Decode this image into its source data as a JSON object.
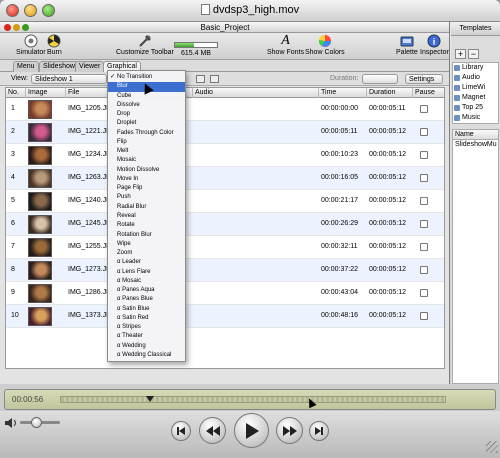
{
  "window": {
    "title": "dvdsp3_high.mov"
  },
  "project": {
    "title": "Basic_Project"
  },
  "toolbar": {
    "simulator_label": "Simulator",
    "burn_label": "Burn",
    "customize_label": "Customize Toolbar",
    "disk_usage_label": "615.4 MB",
    "disk_usage_fraction": 0.45,
    "fonts_label": "Show Fonts",
    "colors_label": "Show Colors",
    "palette_label": "Palette",
    "inspector_label": "Inspector"
  },
  "tabs": {
    "menu": "Menu",
    "slideshow": "Slideshow",
    "viewer": "Viewer",
    "graphical": "Graphical"
  },
  "viewbar": {
    "view_label": "View:",
    "view_value": "Slideshow 1",
    "duration_label": "Duration:",
    "settings_label": "Settings"
  },
  "table": {
    "headers": {
      "no": "No.",
      "image": "Image",
      "file": "File",
      "audio": "Audio",
      "time": "Time",
      "duration": "Duration",
      "pause": "Pause"
    },
    "rows": [
      {
        "no": "1",
        "file": "IMG_1205.JP(",
        "time": "00:00:00:00",
        "duration": "00:00:05:11",
        "thumb_colors": [
          "#7a3a2a",
          "#c78b5a"
        ]
      },
      {
        "no": "2",
        "file": "IMG_1221.JP(",
        "time": "00:00:05:11",
        "duration": "00:00:05:12",
        "thumb_colors": [
          "#3b2a3a",
          "#d45a8a"
        ]
      },
      {
        "no": "3",
        "file": "IMG_1234.JP(",
        "time": "00:00:10:23",
        "duration": "00:00:05:12",
        "thumb_colors": [
          "#2d1a14",
          "#a86b3c"
        ]
      },
      {
        "no": "4",
        "file": "IMG_1263.JP(",
        "time": "00:00:16:05",
        "duration": "00:00:05:12",
        "thumb_colors": [
          "#4a3226",
          "#b79a7a"
        ]
      },
      {
        "no": "5",
        "file": "IMG_1240.JP(",
        "time": "00:00:21:17",
        "duration": "00:00:05:12",
        "thumb_colors": [
          "#1e1a1a",
          "#8a6a4a"
        ]
      },
      {
        "no": "6",
        "file": "IMG_1245.JP(",
        "time": "00:00:26:29",
        "duration": "00:00:05:12",
        "thumb_colors": [
          "#3a2a22",
          "#d8c2a8"
        ]
      },
      {
        "no": "7",
        "file": "IMG_1255.JP(",
        "time": "00:00:32:11",
        "duration": "00:00:05:12",
        "thumb_colors": [
          "#241c18",
          "#9a6a3a"
        ]
      },
      {
        "no": "8",
        "file": "IMG_1273.JP(",
        "time": "00:00:37:22",
        "duration": "00:00:05:12",
        "thumb_colors": [
          "#2a1e1a",
          "#c48a5a"
        ]
      },
      {
        "no": "9",
        "file": "IMG_1286.JP(",
        "time": "00:00:43:04",
        "duration": "00:00:05:12",
        "thumb_colors": [
          "#3a2418",
          "#b07a48"
        ]
      },
      {
        "no": "10",
        "file": "IMG_1373.JP(",
        "time": "00:00:48:16",
        "duration": "00:00:05:12",
        "thumb_colors": [
          "#4a1e2a",
          "#d8a05a"
        ]
      }
    ]
  },
  "transition_menu": {
    "items": [
      "No Transition",
      "Blur",
      "Cube",
      "Dissolve",
      "Drop",
      "Droplet",
      "Fades Through Color",
      "Flip",
      "Melt",
      "Mosaic",
      "Motion Dissolve",
      "Move In",
      "Page Flip",
      "Push",
      "Radial Blur",
      "Reveal",
      "Rotate",
      "Rotation Blur",
      "Wipe",
      "Zoom",
      "α Leader",
      "α Lens Flare",
      "α Mosaic",
      "α Panes Aqua",
      "α Panes Blue",
      "α Satin Blue",
      "α Satin Red",
      "α Stripes",
      "α Theater",
      "α Wedding",
      "α Wedding Classical"
    ],
    "checked_index": 0,
    "highlighted_index": 1
  },
  "right_panel": {
    "tab": "Templates",
    "library_items": [
      "Library",
      "Audio",
      "LimeWi",
      "Magnet",
      "Top 25",
      "Music"
    ],
    "name_header": "Name",
    "name_items": [
      "SlideshowMu"
    ]
  },
  "timeline": {
    "time": "00:00:56",
    "playhead_fraction": 0.23
  },
  "controls": {
    "volume_fraction": 0.4
  },
  "colors": {
    "highlight": "#3d6fd1",
    "alt_row": "#edf3fe",
    "timeline_bg": "#c9cca8"
  }
}
